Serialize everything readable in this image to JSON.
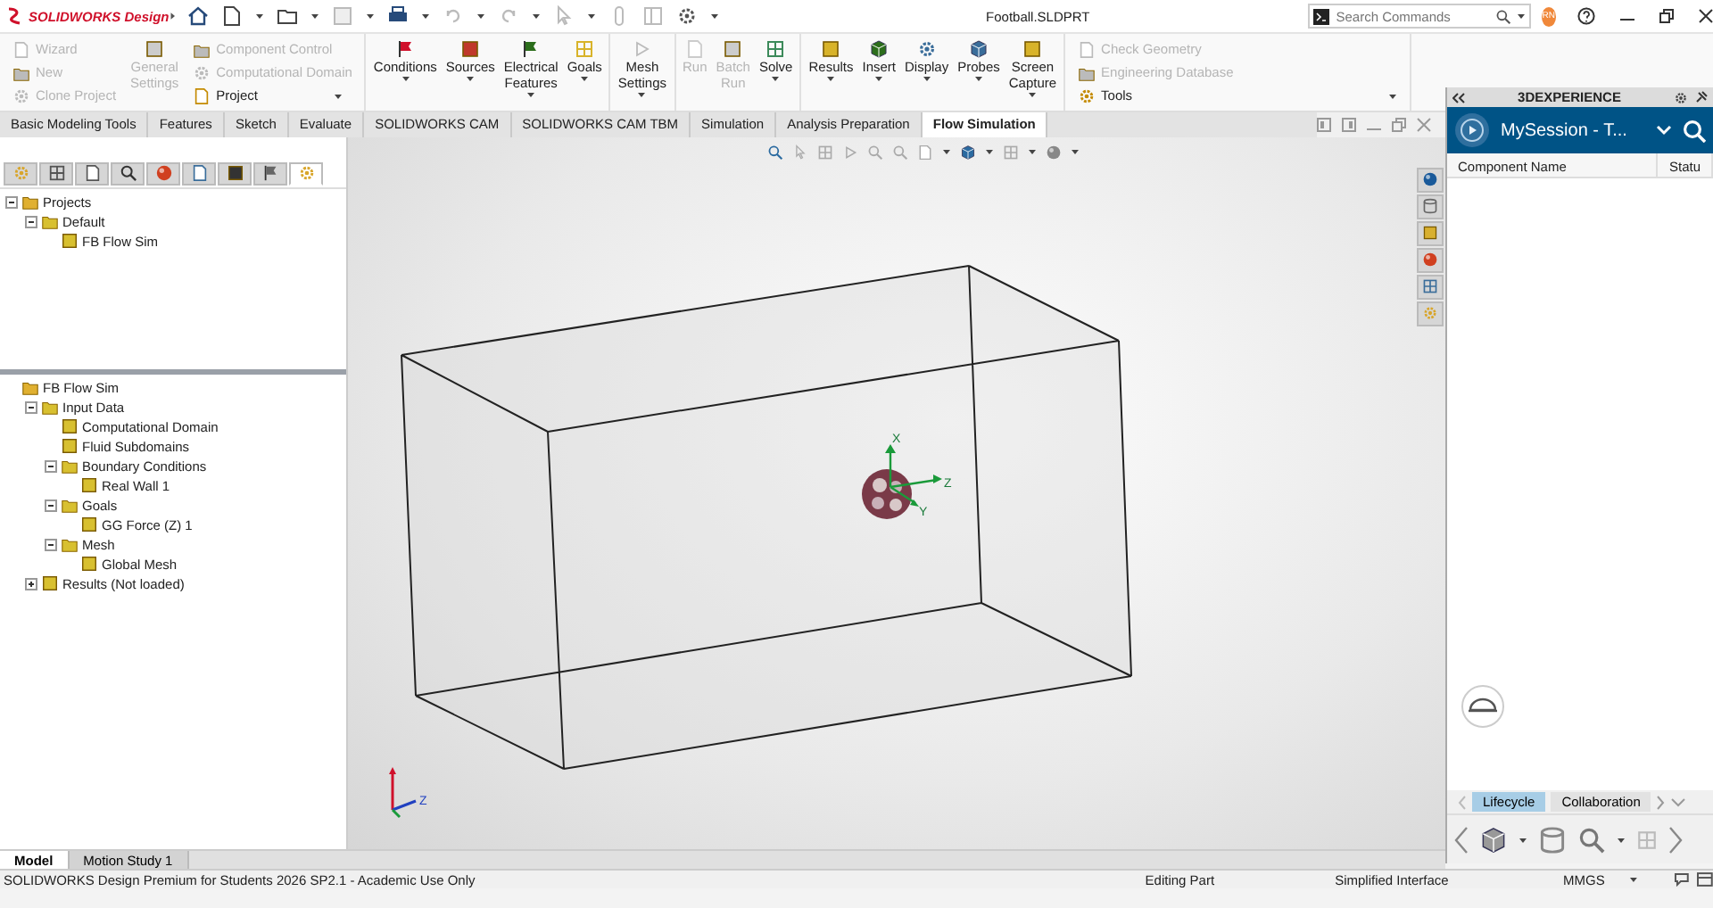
{
  "app": {
    "logo": "SOLIDWORKS Design",
    "title": "Football.SLDPRT",
    "search": {
      "placeholder": "Search Commands"
    },
    "user_initials": "RN"
  },
  "ribbon": {
    "groups": [
      {
        "items": [
          {
            "kind": "small",
            "label": "Wizard",
            "disabled": true,
            "dropdown": false
          },
          {
            "kind": "small",
            "label": "New",
            "disabled": true,
            "dropdown": false
          },
          {
            "kind": "small",
            "label": "Clone Project",
            "disabled": true,
            "dropdown": false
          },
          {
            "kind": "large",
            "label": "General Settings",
            "disabled": true,
            "dropdown": false
          },
          {
            "kind": "small",
            "label": "Component Control",
            "disabled": true,
            "dropdown": false
          },
          {
            "kind": "small",
            "label": "Computational Domain",
            "disabled": true,
            "dropdown": false
          },
          {
            "kind": "small",
            "label": "Project",
            "disabled": false,
            "dropdown": true
          }
        ]
      },
      {
        "items": [
          {
            "kind": "large",
            "label": "Conditions",
            "disabled": false,
            "dropdown": true
          },
          {
            "kind": "large",
            "label": "Sources",
            "disabled": false,
            "dropdown": true
          },
          {
            "kind": "large",
            "label": "Electrical Features",
            "disabled": false,
            "dropdown": true
          },
          {
            "kind": "large",
            "label": "Goals",
            "disabled": false,
            "dropdown": true
          }
        ]
      },
      {
        "items": [
          {
            "kind": "large",
            "label": "Mesh Settings",
            "disabled": false,
            "dropdown": true
          }
        ]
      },
      {
        "items": [
          {
            "kind": "large",
            "label": "Run",
            "disabled": true,
            "dropdown": false
          },
          {
            "kind": "large",
            "label": "Batch Run",
            "disabled": true,
            "dropdown": false
          },
          {
            "kind": "large",
            "label": "Solve",
            "disabled": false,
            "dropdown": true
          }
        ]
      },
      {
        "items": [
          {
            "kind": "large",
            "label": "Results",
            "disabled": false,
            "dropdown": true
          },
          {
            "kind": "large",
            "label": "Insert",
            "disabled": false,
            "dropdown": true
          },
          {
            "kind": "large",
            "label": "Display",
            "disabled": false,
            "dropdown": true
          },
          {
            "kind": "large",
            "label": "Probes",
            "disabled": false,
            "dropdown": true
          },
          {
            "kind": "large",
            "label": "Screen Capture",
            "disabled": false,
            "dropdown": true
          }
        ]
      },
      {
        "items": [
          {
            "kind": "small",
            "label": "Check Geometry",
            "disabled": true,
            "dropdown": false
          },
          {
            "kind": "small",
            "label": "Engineering Database",
            "disabled": true,
            "dropdown": false
          },
          {
            "kind": "small",
            "label": "Tools",
            "disabled": false,
            "dropdown": true
          }
        ]
      }
    ]
  },
  "tabs": [
    {
      "label": "Basic Modeling Tools",
      "selected": false
    },
    {
      "label": "Features",
      "selected": false
    },
    {
      "label": "Sketch",
      "selected": false
    },
    {
      "label": "Evaluate",
      "selected": false
    },
    {
      "label": "SOLIDWORKS CAM",
      "selected": false
    },
    {
      "label": "SOLIDWORKS CAM TBM",
      "selected": false
    },
    {
      "label": "Simulation",
      "selected": false
    },
    {
      "label": "Analysis Preparation",
      "selected": false
    },
    {
      "label": "Flow Simulation",
      "selected": true
    }
  ],
  "panel_tabs": [
    {
      "selected": false
    },
    {
      "selected": false
    },
    {
      "selected": false
    },
    {
      "selected": false
    },
    {
      "selected": false
    },
    {
      "selected": false
    },
    {
      "selected": false
    },
    {
      "selected": false
    },
    {
      "selected": true
    }
  ],
  "project_tree": [
    {
      "label": "Projects",
      "expanded": true,
      "children": [
        {
          "label": "Default",
          "expanded": true,
          "children": [
            {
              "label": "FB Flow Sim"
            }
          ]
        }
      ]
    }
  ],
  "analysis_tree": [
    {
      "label": "FB Flow Sim",
      "children": [
        {
          "label": "Input Data",
          "expanded": true,
          "children": [
            {
              "label": "Computational Domain"
            },
            {
              "label": "Fluid Subdomains"
            },
            {
              "label": "Boundary Conditions",
              "expanded": true,
              "children": [
                {
                  "label": "Real Wall 1"
                }
              ]
            },
            {
              "label": "Goals",
              "expanded": true,
              "children": [
                {
                  "label": "GG Force (Z) 1"
                }
              ]
            },
            {
              "label": "Mesh",
              "expanded": true,
              "children": [
                {
                  "label": "Global Mesh"
                }
              ]
            }
          ]
        },
        {
          "label": "Results (Not loaded)",
          "expanded": false
        }
      ]
    }
  ],
  "viewport": {
    "model_axes": [
      "X",
      "Z",
      "Y"
    ],
    "view_triad": [
      "Z"
    ]
  },
  "bottom_tabs": [
    {
      "label": "Model",
      "selected": true
    },
    {
      "label": "Motion Study 1",
      "selected": false
    }
  ],
  "side_panel": {
    "title": "3DEXPERIENCE",
    "session": "MySession - T...",
    "columns": [
      "Component Name",
      "Statu"
    ],
    "tabs": [
      {
        "label": "Lifecycle",
        "selected": true
      },
      {
        "label": "Collaboration",
        "selected": false
      }
    ]
  },
  "status_bar": {
    "product": "SOLIDWORKS Design Premium for Students 2026 SP2.1 - Academic Use Only",
    "mode": "Editing Part",
    "interface": "Simplified Interface",
    "units": "MMGS"
  }
}
